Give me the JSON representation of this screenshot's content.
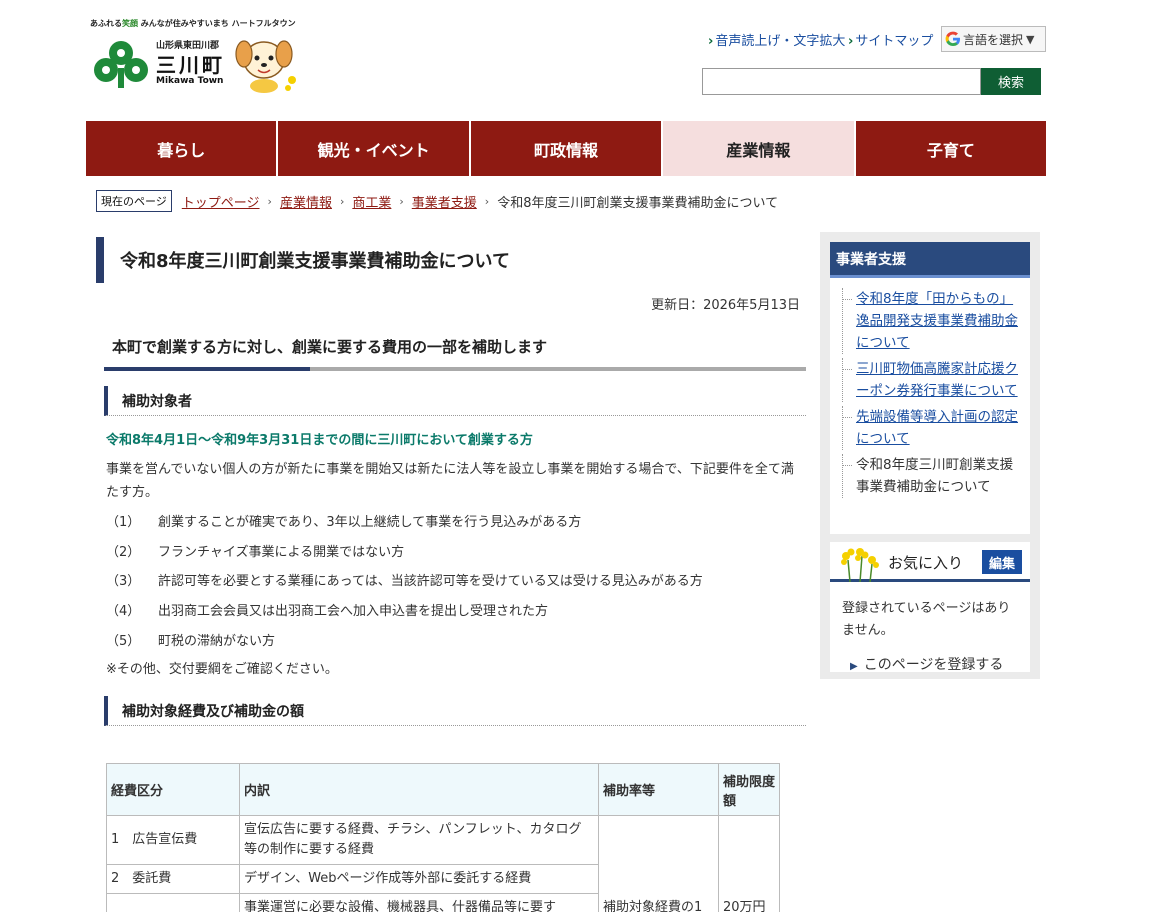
{
  "header": {
    "tagline_prefix": "あふれる",
    "tagline_green": "笑顔",
    "tagline_rest": " みんなが住みやすいまち ハートフルタウン",
    "pref": "山形県東田川郡",
    "town": "三川町",
    "town_en": "Mikawa Town",
    "util_links": [
      "音声読上げ・文字拡大",
      "サイトマップ"
    ],
    "language_label": "言語を選択",
    "search_placeholder": "",
    "search_button": "検索"
  },
  "nav": [
    "暮らし",
    "観光・イベント",
    "町政情報",
    "産業情報",
    "子育て"
  ],
  "nav_active": "産業情報",
  "breadcrumb": {
    "here_label": "現在のページ",
    "links": [
      "トップページ",
      "産業情報",
      "商工業",
      "事業者支援"
    ],
    "current": "令和8年度三川町創業支援事業費補助金について"
  },
  "main": {
    "title": "令和8年度三川町創業支援事業費補助金について",
    "updated": "更新日：2026年5月13日",
    "lead": "本町で創業する方に対し、創業に要する費用の一部を補助します",
    "section1_heading": "補助対象者",
    "period": "令和8年4月1日～令和9年3月31日までの間に三川町において創業する方",
    "intro": "事業を営んでいない個人の方が新たに事業を開始又は新たに法人等を設立し事業を開始する場合で、下記要件を全て満たす方。",
    "conditions": [
      {
        "num": "（1）",
        "text": "創業することが確実であり、3年以上継続して事業を行う見込みがある方"
      },
      {
        "num": "（2）",
        "text": "フランチャイズ事業による開業ではない方"
      },
      {
        "num": "（3）",
        "text": "許認可等を必要とする業種にあっては、当該許認可等を受けている又は受ける見込みがある方"
      },
      {
        "num": "（4）",
        "text": "出羽商工会会員又は出羽商工会へ加入申込書を提出し受理された方"
      },
      {
        "num": "（5）",
        "text": "町税の滞納がない方"
      }
    ],
    "note": "※その他、交付要綱をご確認ください。",
    "section2_heading": "補助対象経費及び補助金の額",
    "table": {
      "headers": [
        "経費区分",
        "内訳",
        "補助率等",
        "補助限度額"
      ],
      "rows": [
        {
          "category": "1　広告宣伝費",
          "detail": "宣伝広告に要する経費、チラシ、パンフレット、カタログ等の制作に要する経費"
        },
        {
          "category": "2　委託費",
          "detail": "デザイン、Webページ作成等外部に委託する経費"
        },
        {
          "category": "",
          "detail": "事業運営に必要な設備、機械器具、什器備品等に要す"
        }
      ],
      "rate": "補助対象経費の1",
      "limit": "20万円"
    }
  },
  "sidebar": {
    "heading": "事業者支援",
    "items": [
      {
        "label": "令和8年度「田からもの」逸品開発支援事業費補助金について",
        "link": true
      },
      {
        "label": "三川町物価高騰家計応援クーポン券発行事業について",
        "link": true
      },
      {
        "label": "先端設備等導入計画の認定について",
        "link": true
      },
      {
        "label": "令和8年度三川町創業支援事業費補助金について",
        "link": false
      }
    ],
    "favorites_title": "お気に入り",
    "favorites_edit": "編集",
    "favorites_empty": "登録されているページはありません。",
    "favorites_add": "このページを登録する"
  }
}
